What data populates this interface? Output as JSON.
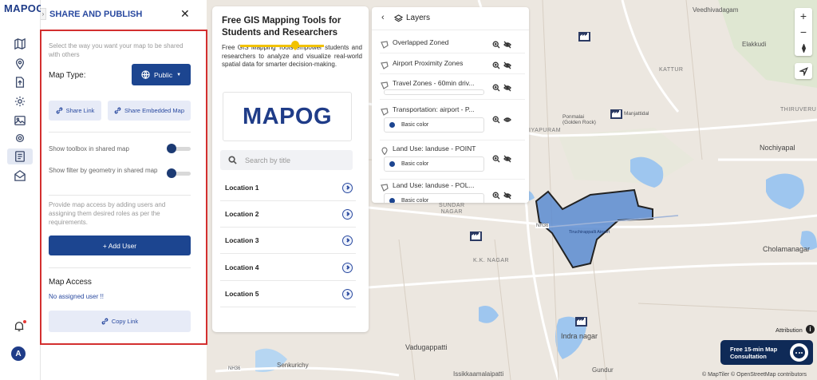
{
  "app": {
    "logo": "MAPOG"
  },
  "rail": {
    "icons": [
      "book-map-icon",
      "location-pin-icon",
      "upload-file-icon",
      "settings-icon",
      "image-layer-icon",
      "gear-icon",
      "share-map-icon",
      "mail-icon"
    ],
    "avatar_initial": "A"
  },
  "share_panel": {
    "title": "SHARE AND PUBLISH",
    "intro": "Select the way you want your map to be shared with others",
    "map_type_label": "Map Type:",
    "map_type_value": "Public",
    "share_link_label": "Share Link",
    "embed_label": "Share Embedded Map",
    "toolbox_label": "Show toolbox in shared map",
    "filter_label": "Show filter by geometry in shared map",
    "access_intro": "Provide map access by adding users and assigning them desired roles as per the requirements.",
    "add_user_label": "+ Add User",
    "map_access_title": "Map Access",
    "no_user_text": "No assigned user !!",
    "copy_link_label": "Copy Link"
  },
  "ad_card": {
    "title": "Free GIS Mapping Tools for Students and Researchers",
    "description": "Free GIS Mapping Tools empower students and researchers to analyze and visualize real-world spatial data for smarter decision-making.",
    "logo_text": "MAPOG",
    "search_placeholder": "Search by title",
    "locations": [
      "Location 1",
      "Location 2",
      "Location 3",
      "Location 4",
      "Location 5"
    ]
  },
  "layers": {
    "title": "Layers",
    "items": [
      {
        "name": "Overlapped Zoned",
        "style": ""
      },
      {
        "name": "Airport Proximity Zones",
        "style": ""
      },
      {
        "name": "Travel Zones - 60min driv...",
        "style": ""
      },
      {
        "name": "Transportation: airport - P...",
        "style": "Basic color"
      },
      {
        "name": "Land Use: landuse - POINT",
        "style": "Basic color"
      },
      {
        "name": "Land Use: landuse - POL...",
        "style": "Basic color"
      }
    ]
  },
  "map": {
    "labels": {
      "veedhi": "Veedhivadagam",
      "elakkudi": "Elakkudi",
      "kattur": "KATTUR",
      "thiruveru": "THIRUVERU",
      "nochiyapal": "Nochiyapal",
      "pommalai": "Ponmalai\n(Golden Rock)",
      "manjattidal": "Manjattidal",
      "vayapuram": "IYAPURAM",
      "sundar": "SUNDAR\nNAGAR",
      "kknagar": "K.K. NAGAR",
      "chola": "Cholamanagar",
      "indra": "Indra nagar",
      "vaduga": "Vadugappatti",
      "senkuru": "Senkurichy",
      "issik": "Issikkaamalaipatti",
      "gundur": "Gundur",
      "nh36a": "NH36",
      "nh36b": "NH36",
      "airport": "Tiruchirappalli Airport"
    },
    "polygon_color": "#5b8bd0"
  },
  "controls": {
    "zoom_in": "+",
    "zoom_out": "−",
    "attribution": "Attribution",
    "consult": "Free 15-min Map\nConsultation",
    "credits": "© MapTiler © OpenStreetMap contributors"
  }
}
